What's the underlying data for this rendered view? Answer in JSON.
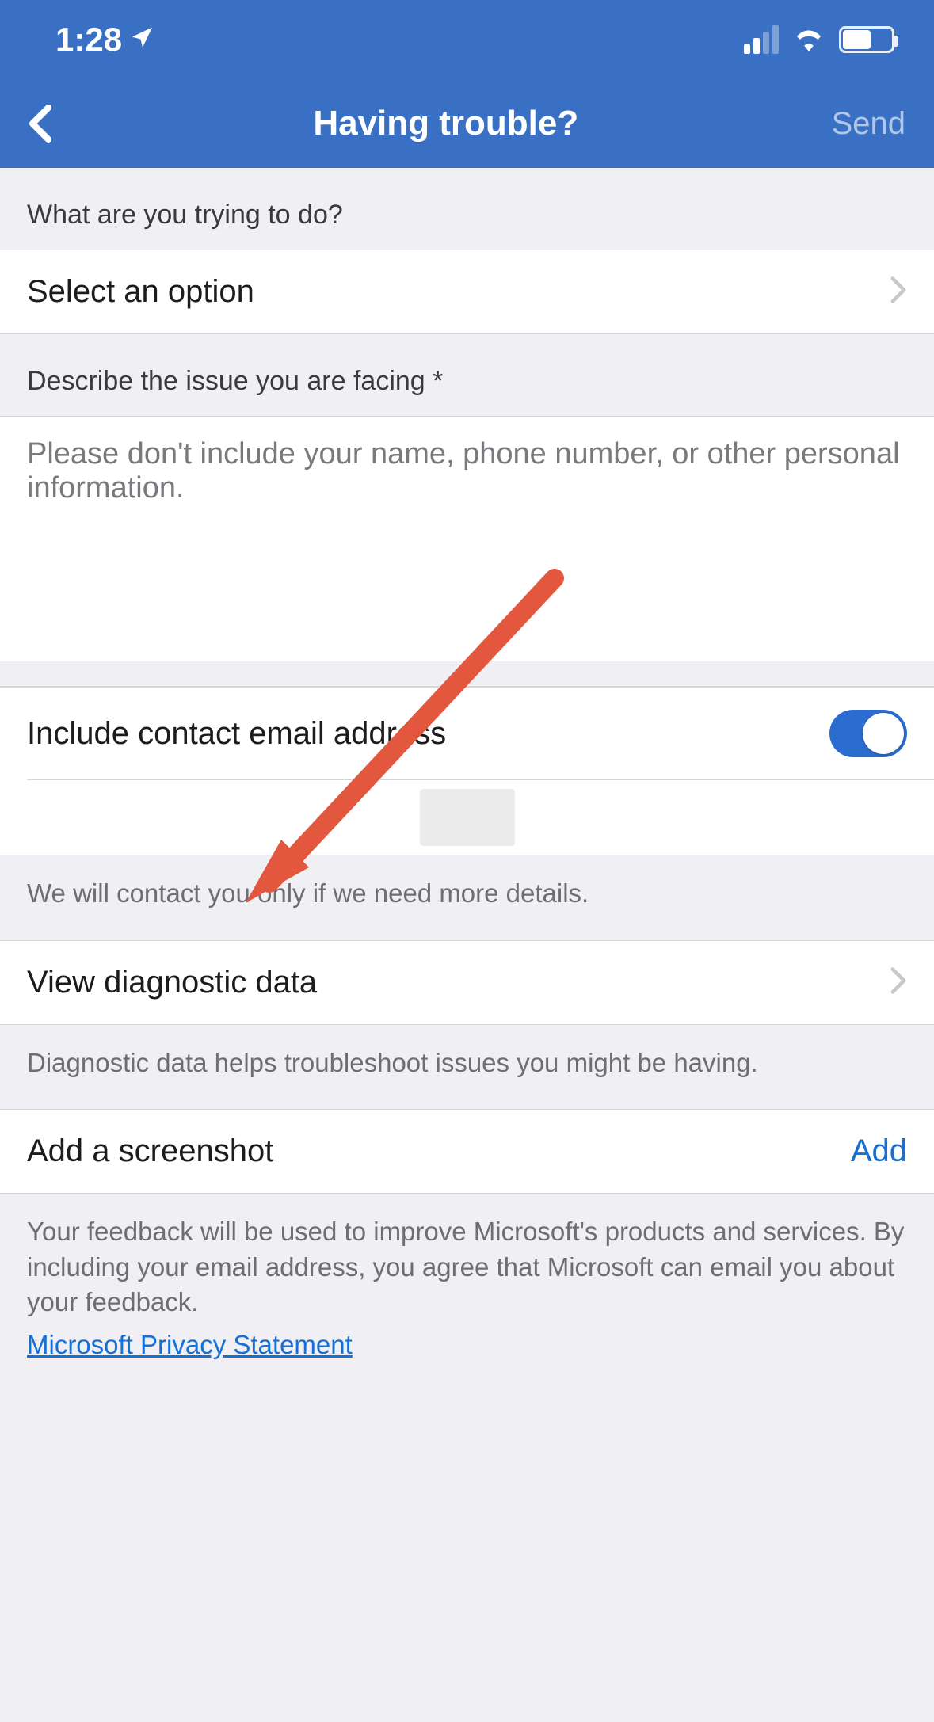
{
  "statusbar": {
    "time": "1:28"
  },
  "navbar": {
    "title": "Having trouble?",
    "send_label": "Send"
  },
  "option_section": {
    "header": "What are you trying to do?",
    "select_label": "Select an option"
  },
  "issue_section": {
    "header": "Describe the issue you are facing *",
    "placeholder": "Please don't include your name, phone number, or other personal information."
  },
  "contact": {
    "toggle_label": "Include contact email address",
    "note": "We will contact you only if we need more details."
  },
  "diagnostic": {
    "label": "View diagnostic data",
    "note": "Diagnostic data helps troubleshoot issues you might be having."
  },
  "screenshot": {
    "label": "Add a screenshot",
    "add_label": "Add"
  },
  "footer": {
    "disclaimer": "Your feedback will be used to improve Microsoft's products and services. By including your email address, you agree that Microsoft can email you about your feedback.",
    "privacy_link": "Microsoft Privacy Statement"
  }
}
